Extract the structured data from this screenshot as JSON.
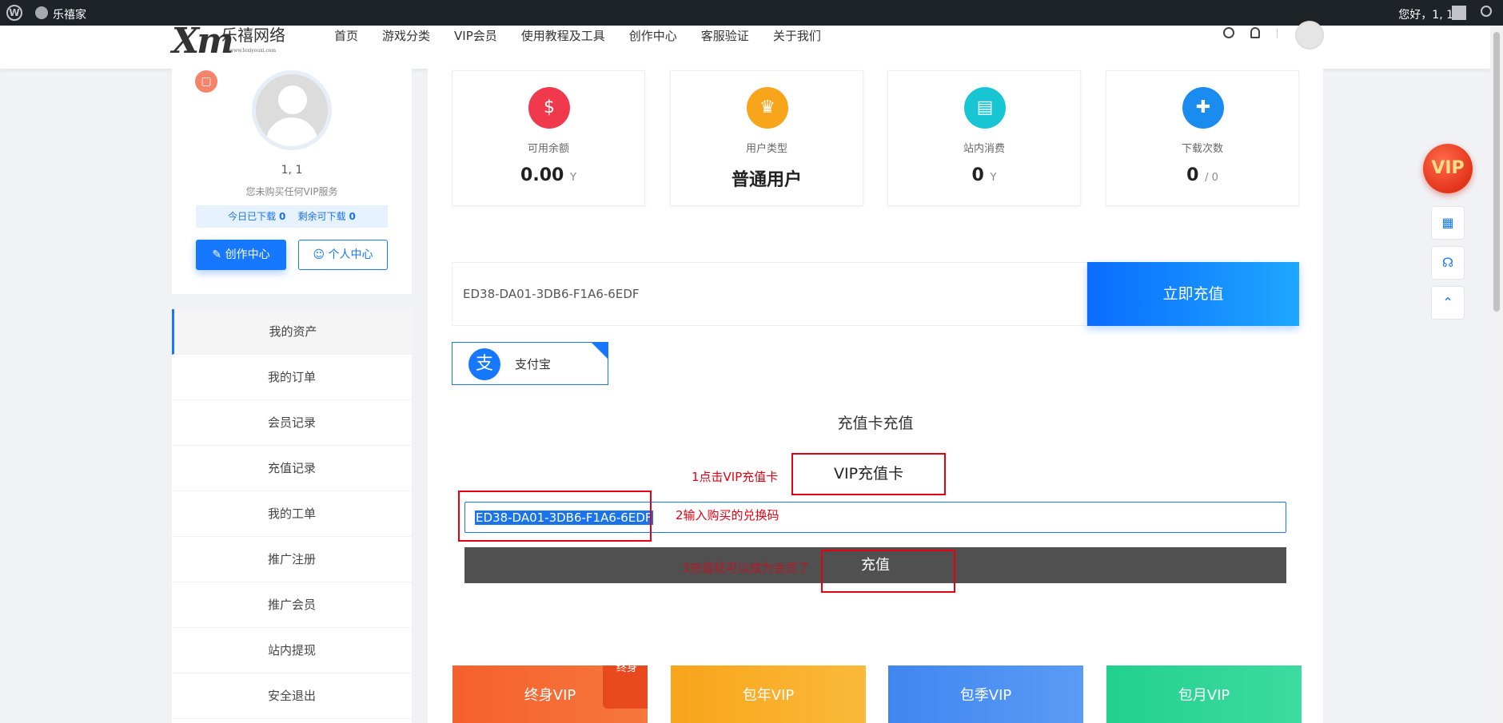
{
  "adminbar": {
    "site_name": "乐禧家",
    "greeting": "您好，1, 1"
  },
  "header": {
    "logo_text": "乐禧网络",
    "logo_mark": "Xm",
    "logo_small": "www.lexiyouxi.com",
    "nav": [
      "首页",
      "游戏分类",
      "VIP会员",
      "使用教程及工具",
      "创作中心",
      "客服验证",
      "关于我们"
    ]
  },
  "profile": {
    "username": "1, 1",
    "vip_note": "您未购买任何VIP服务",
    "today_downloaded_label": "今日已下载",
    "today_downloaded": "0",
    "remaining_label": "剩余可下载",
    "remaining": "0",
    "create_button": "创作中心",
    "profile_button": "个人中心"
  },
  "menu": [
    "我的资产",
    "我的订单",
    "会员记录",
    "充值记录",
    "我的工单",
    "推广注册",
    "推广会员",
    "站内提现",
    "安全退出"
  ],
  "stats": [
    {
      "label": "可用余额",
      "value": "0.00",
      "unit": "Y",
      "color": "#f0394d",
      "icon": "money-bag-icon"
    },
    {
      "label": "用户类型",
      "value": "普通用户",
      "unit": "",
      "color": "#f8a51b",
      "icon": "crown-icon"
    },
    {
      "label": "站内消费",
      "value": "0",
      "unit": "Y",
      "color": "#17c6d2",
      "icon": "cart-icon"
    },
    {
      "label": "下载次数",
      "value": "0",
      "unit": "/ 0",
      "color": "#1a8cf0",
      "icon": "gift-icon"
    }
  ],
  "recharge": {
    "input_value": "ED38-DA01-3DB6-F1A6-6EDF",
    "button": "立即充值",
    "pay_method": "支付宝"
  },
  "card_recharge": {
    "title": "充值卡充值",
    "vip_card_label": "VIP充值卡",
    "code_value": "ED38-DA01-3DB6-F1A6-6EDF",
    "submit": "充值",
    "anno1": "1点击VIP充值卡",
    "anno2": "2输入购买的兑换码",
    "anno3": "3充值就可以成为会员了"
  },
  "vip_plans": [
    {
      "name": "终身VIP",
      "tag": "终身",
      "color": "#f5602d"
    },
    {
      "name": "包年VIP",
      "color": "#f8a51b"
    },
    {
      "name": "包季VIP",
      "color": "#3f86f0"
    },
    {
      "name": "包月VIP",
      "color": "#22d08e"
    }
  ],
  "float": {
    "vip": "VIP"
  }
}
